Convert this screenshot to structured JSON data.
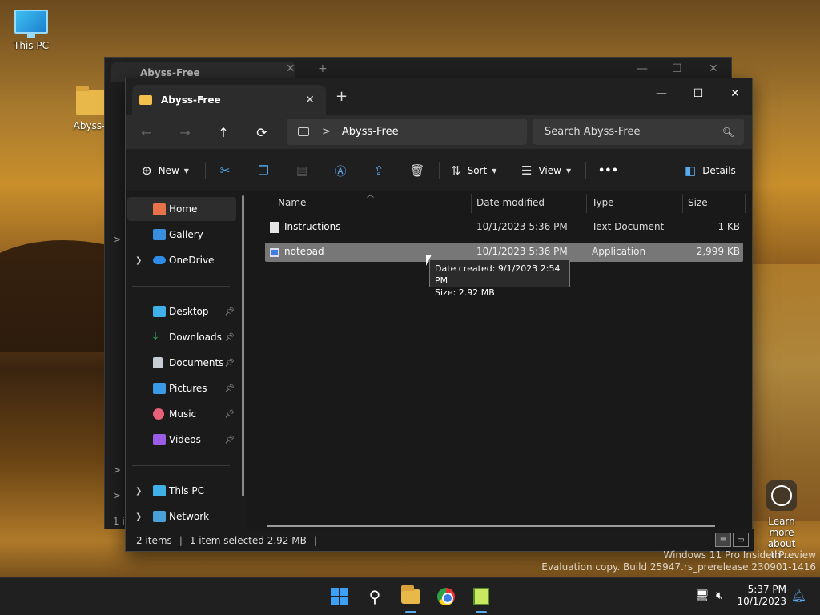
{
  "desktop": {
    "icons": [
      {
        "label": "This PC"
      },
      {
        "label": "Abyss-F"
      }
    ],
    "learn_more": "Learn more about thi...",
    "watermark": {
      "line1": "Windows 11 Pro Insider Preview",
      "line2": "Evaluation copy. Build 25947.rs_prerelease.230901-1416"
    }
  },
  "bg_window": {
    "tab_title": "Abyss-Free",
    "new_tab": "+",
    "controls": [
      "—",
      "☐",
      "✕"
    ],
    "side_arrows": [
      ">",
      ">",
      ">"
    ],
    "status_fragment": "1 i"
  },
  "window": {
    "tab_title": "Abyss-Free",
    "tab_close": "✕",
    "new_tab": "+",
    "controls": {
      "minimize": "—",
      "maximize": "☐",
      "close": "✕"
    },
    "nav_buttons": {
      "back": "←",
      "forward": "→",
      "up": "↑",
      "refresh": "⟳"
    },
    "breadcrumb": {
      "separator": ">",
      "path": "Abyss-Free"
    },
    "search_placeholder": "Search Abyss-Free",
    "commands": {
      "new": "New",
      "sort": "Sort",
      "view": "View",
      "more": "•••",
      "details": "Details"
    },
    "nav": {
      "home": "Home",
      "gallery": "Gallery",
      "onedrive": "OneDrive",
      "desktop": "Desktop",
      "downloads": "Downloads",
      "documents": "Documents",
      "pictures": "Pictures",
      "music": "Music",
      "videos": "Videos",
      "thispc": "This PC",
      "network": "Network"
    },
    "columns": {
      "name": "Name",
      "date": "Date modified",
      "type": "Type",
      "size": "Size"
    },
    "files": [
      {
        "name": "Instructions",
        "date": "10/1/2023 5:36 PM",
        "type": "Text Document",
        "size": "1 KB"
      },
      {
        "name": "notepad",
        "date": "10/1/2023 5:36 PM",
        "type": "Application",
        "size": "2,999 KB"
      }
    ],
    "tooltip": {
      "line1": "Date created: 9/1/2023 2:54 PM",
      "line2": "Size: 2.92 MB"
    },
    "status": {
      "items": "2 items",
      "selected": "1 item selected  2.92 MB",
      "bar": "|"
    }
  },
  "taskbar": {
    "time": "5:37 PM",
    "date": "10/1/2023"
  },
  "colors": {
    "accent": "#5aaaf0",
    "selection": "#777777",
    "window_bg": "#191919"
  }
}
